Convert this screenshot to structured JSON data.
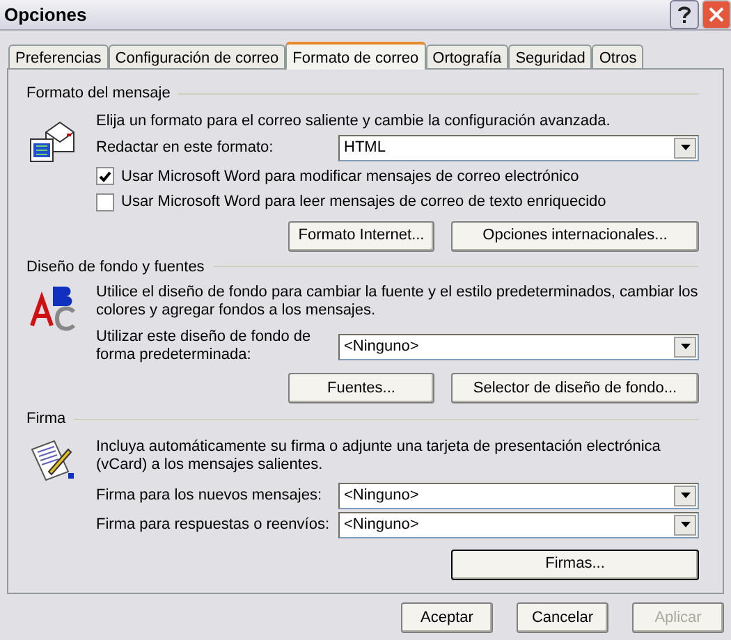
{
  "window": {
    "title": "Opciones"
  },
  "tabs": [
    {
      "label": "Preferencias",
      "selected": false
    },
    {
      "label": "Configuración de correo",
      "selected": false
    },
    {
      "label": "Formato de correo",
      "selected": true
    },
    {
      "label": "Ortografía",
      "selected": false
    },
    {
      "label": "Seguridad",
      "selected": false
    },
    {
      "label": "Otros",
      "selected": false
    }
  ],
  "message_format": {
    "title": "Formato del mensaje",
    "description": "Elija un formato para el correo saliente y cambie la configuración avanzada.",
    "compose_label": "Redactar en este formato:",
    "compose_value": "HTML",
    "checkboxes": [
      {
        "label": "Usar Microsoft Word para modificar mensajes de correo electrónico",
        "checked": true
      },
      {
        "label": "Usar Microsoft Word para leer mensajes de correo de texto enriquecido",
        "checked": false
      }
    ],
    "buttons": [
      "Formato Internet...",
      "Opciones internacionales..."
    ]
  },
  "stationery": {
    "title": "Diseño de fondo y fuentes",
    "description": "Utilice el diseño de fondo para cambiar la fuente y el estilo predeterminados, cambiar los colores y agregar fondos a los mensajes.",
    "default_label": "Utilizar este diseño de fondo de forma predeterminada:",
    "default_value": "<Ninguno>",
    "buttons": [
      "Fuentes...",
      "Selector de diseño de fondo..."
    ]
  },
  "signature": {
    "title": "Firma",
    "description": "Incluya automáticamente su firma o adjunte una tarjeta de presentación electrónica (vCard) a los mensajes salientes.",
    "fields": [
      {
        "label": "Firma para los nuevos mensajes:",
        "value": "<Ninguno>"
      },
      {
        "label": "Firma para respuestas o reenvíos:",
        "value": "<Ninguno>"
      }
    ],
    "buttons": [
      "Firmas..."
    ]
  },
  "dialog_buttons": [
    {
      "label": "Aceptar",
      "disabled": false
    },
    {
      "label": "Cancelar",
      "disabled": false
    },
    {
      "label": "Aplicar",
      "disabled": true
    }
  ]
}
